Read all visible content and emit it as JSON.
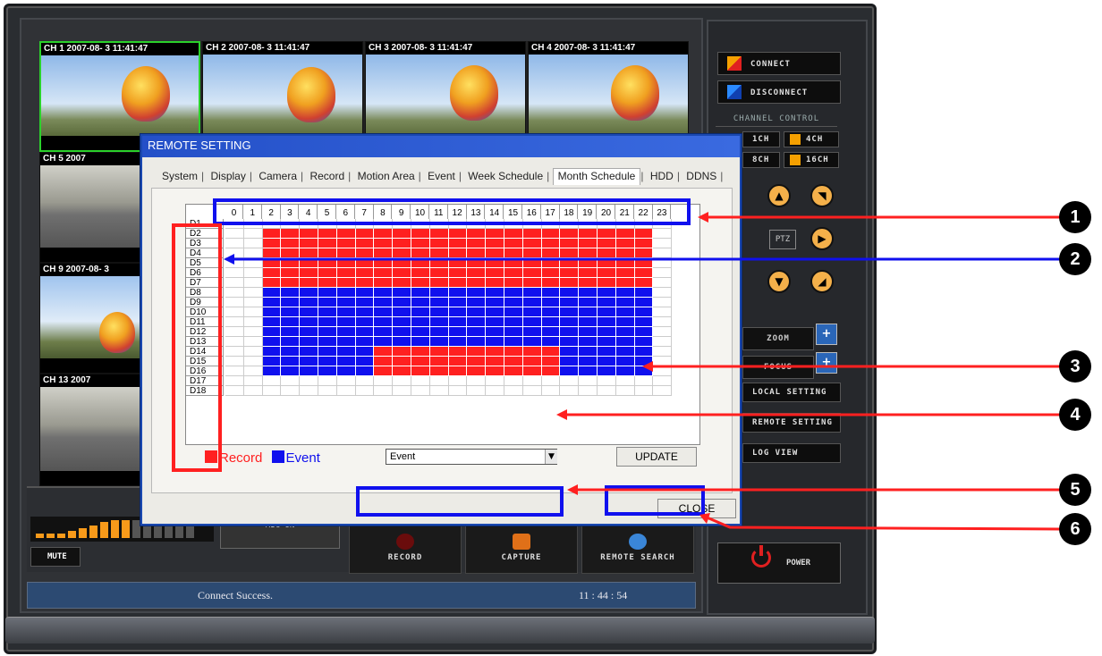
{
  "channels": [
    {
      "title": "CH 1 2007-08- 3 11:41:47"
    },
    {
      "title": "CH 2 2007-08- 3 11:41:47"
    },
    {
      "title": "CH 3 2007-08- 3 11:41:47"
    },
    {
      "title": "CH 4 2007-08- 3 11:41:47"
    },
    {
      "title": "CH 5 2007"
    },
    {
      "title": "CH 9 2007-08- 3"
    },
    {
      "title": "CH 13 2007"
    }
  ],
  "audio": {
    "mute_label": "MUTE",
    "mic_label": "MIC-ON"
  },
  "actions": [
    {
      "label": "RECORD",
      "icon": "record-dot-icon"
    },
    {
      "label": "CAPTURE",
      "icon": "camera-icon"
    },
    {
      "label": "REMOTE SEARCH",
      "icon": "magnifier-icon"
    }
  ],
  "status": {
    "message": "Connect Success.",
    "time": "11 : 44 : 54"
  },
  "right": {
    "connect": "CONNECT",
    "disconnect": "DISCONNECT",
    "channel_control": "CHANNEL CONTROL",
    "ch1": "1CH",
    "ch4": "4CH",
    "ch8": "8CH",
    "ch16": "16CH",
    "ptz": "PTZ",
    "zoom": "ZOOM",
    "focus": "FOCUS",
    "local_setting": "LOCAL SETTING",
    "remote_setting": "REMOTE SETTING",
    "log_view": "LOG VIEW",
    "power": "POWER"
  },
  "dialog": {
    "title": "REMOTE SETTING",
    "tabs": [
      "System",
      "Display",
      "Camera",
      "Record",
      "Motion Area",
      "Event",
      "Week Schedule",
      "Month Schedule",
      "HDD",
      "DDNS"
    ],
    "active_tab": "Month Schedule",
    "hours": [
      "0",
      "1",
      "2",
      "3",
      "4",
      "5",
      "6",
      "7",
      "8",
      "9",
      "10",
      "11",
      "12",
      "13",
      "14",
      "15",
      "16",
      "17",
      "18",
      "19",
      "20",
      "21",
      "22",
      "23"
    ],
    "days": [
      "D1",
      "D2",
      "D3",
      "D4",
      "D5",
      "D6",
      "D7",
      "D8",
      "D9",
      "D10",
      "D11",
      "D12",
      "D13",
      "D14",
      "D15",
      "D16",
      "D17",
      "D18"
    ],
    "legend_record": "Record",
    "legend_event": "Event",
    "mode_value": "Event",
    "update_label": "UPDATE",
    "close_label": "CLOSE",
    "colors": {
      "record": "#ff2020",
      "event": "#1010ee"
    },
    "schedule": {
      "record_block_1": {
        "days": "D2-D7",
        "hours": "2-22"
      },
      "event_block": {
        "days": "D8-D16",
        "hours": "2-22"
      },
      "record_block_2": {
        "days": "D14-D16",
        "hours": "8-17"
      }
    }
  },
  "callouts": [
    "1",
    "2",
    "3",
    "4",
    "5",
    "6"
  ]
}
